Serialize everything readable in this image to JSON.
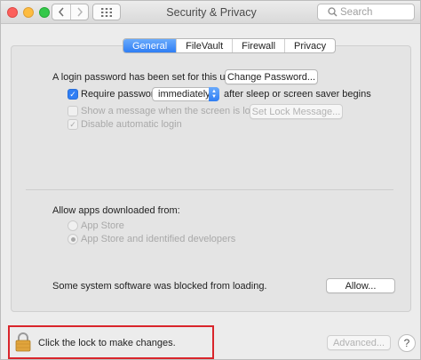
{
  "window": {
    "title": "Security & Privacy",
    "search_placeholder": "Search"
  },
  "tabs": [
    {
      "label": "General",
      "active": true
    },
    {
      "label": "FileVault",
      "active": false
    },
    {
      "label": "Firewall",
      "active": false
    },
    {
      "label": "Privacy",
      "active": false
    }
  ],
  "general": {
    "login_password_text": "A login password has been set for this user",
    "change_password_label": "Change Password...",
    "require_password": {
      "label": "Require password",
      "checked": true,
      "delay_value": "immediately",
      "suffix": "after sleep or screen saver begins"
    },
    "show_message": {
      "label": "Show a message when the screen is locked",
      "checked": false,
      "enabled": false,
      "button_label": "Set Lock Message..."
    },
    "disable_auto_login": {
      "label": "Disable automatic login",
      "checked": true,
      "enabled": false
    }
  },
  "allow_apps": {
    "heading": "Allow apps downloaded from:",
    "options": [
      {
        "label": "App Store",
        "selected": false
      },
      {
        "label": "App Store and identified developers",
        "selected": true
      }
    ]
  },
  "blocked": {
    "text": "Some system software was blocked from loading.",
    "allow_label": "Allow..."
  },
  "footer": {
    "lock_text": "Click the lock to make changes.",
    "advanced_label": "Advanced...",
    "help_label": "?"
  },
  "colors": {
    "accent": "#2f7ef4",
    "highlight_border": "#d9252b",
    "lock": "#e0a43c"
  },
  "icons": {
    "back": "chevron-left-icon",
    "forward": "chevron-right-icon",
    "grid": "grid-icon",
    "search": "search-icon",
    "lock": "lock-icon"
  }
}
